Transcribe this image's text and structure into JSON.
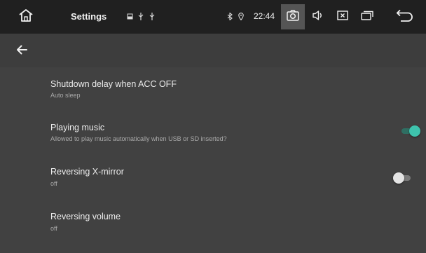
{
  "status_bar": {
    "title": "Settings",
    "time": "22:44",
    "icons": {
      "home": "home-icon",
      "notifications": [
        "image-icon",
        "usb-icon",
        "usb-icon"
      ],
      "system": [
        "bluetooth-icon",
        "location-icon"
      ],
      "camera": "camera-icon",
      "volume": "volume-icon",
      "close": "close-box-icon",
      "recent": "recent-apps-icon",
      "back": "back-icon"
    }
  },
  "toolbar": {
    "back_icon": "arrow-left-icon"
  },
  "settings": [
    {
      "title": "Shutdown delay when ACC OFF",
      "summary": "Auto sleep"
    },
    {
      "title": "Playing music",
      "summary": "Allowed to play music automatically when USB or SD inserted?",
      "toggle": "on"
    },
    {
      "title": "Reversing X-mirror",
      "summary": "off",
      "toggle": "off"
    },
    {
      "title": "Reversing volume",
      "summary": "off"
    }
  ],
  "colors": {
    "status_bar_bg": "#202020",
    "content_bg": "#414141",
    "toggle_on": "#3ec3ad",
    "toggle_off": "#e4e4e4"
  }
}
